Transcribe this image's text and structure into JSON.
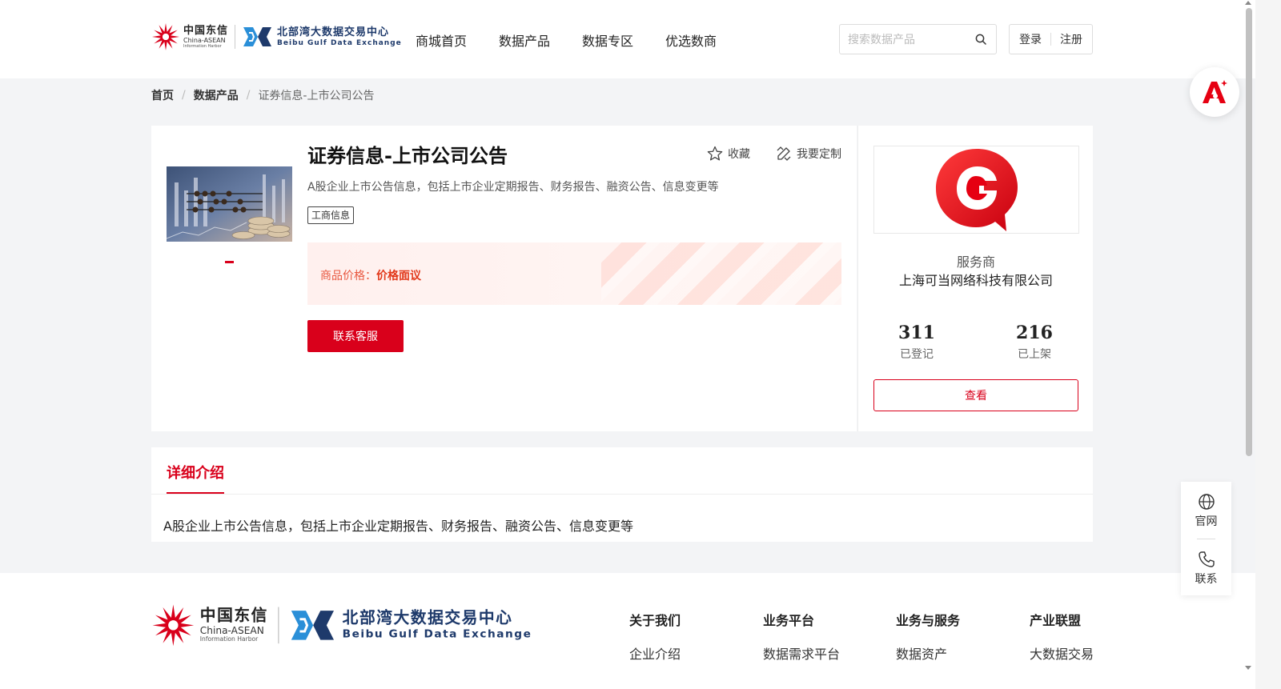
{
  "header": {
    "logo": {
      "cn_name": "中国东信",
      "en_name": "China-ASEAN",
      "en_sub": "Information Harbor",
      "exchange_cn": "北部湾大数据交易中心",
      "exchange_en": "Beibu Gulf Data Exchange"
    },
    "nav": [
      "商城首页",
      "数据产品",
      "数据专区",
      "优选数商"
    ],
    "search": {
      "placeholder": "搜索数据产品",
      "icon": "search-icon"
    },
    "login_label": "登录",
    "register_label": "注册"
  },
  "breadcrumb": [
    "首页",
    "数据产品",
    "证券信息-上市公司公告"
  ],
  "product": {
    "title": "证券信息-上市公司公告",
    "favorite_label": "收藏",
    "customize_label": "我要定制",
    "description": "A股企业上市公告信息，包括上市企业定期报告、财务报告、融资公告、信息变更等",
    "tag": "工商信息",
    "price_label": "商品价格：",
    "price_value": "价格面议",
    "contact_label": "联系客服"
  },
  "provider": {
    "label": "服务商",
    "name": "上海可当网络科技有限公司",
    "stats": [
      {
        "value": "311",
        "label": "已登记"
      },
      {
        "value": "216",
        "label": "已上架"
      }
    ],
    "view_label": "查看",
    "brand_color": "#e60012"
  },
  "detail": {
    "tab_label": "详细介绍",
    "text": "A股企业上市公告信息，包括上市企业定期报告、财务报告、融资公告、信息变更等"
  },
  "footer": {
    "columns": [
      {
        "title": "关于我们",
        "link": "企业介绍"
      },
      {
        "title": "业务平台",
        "link": "数据需求平台"
      },
      {
        "title": "业务与服务",
        "link": "数据资产"
      },
      {
        "title": "产业联盟",
        "link": "大数据交易"
      }
    ]
  },
  "side_tools": [
    {
      "label": "官网",
      "icon": "globe-icon"
    },
    {
      "label": "联系",
      "icon": "phone-icon"
    }
  ],
  "theme": {
    "accent": "#d9001b",
    "price_color": "#e8573f"
  }
}
